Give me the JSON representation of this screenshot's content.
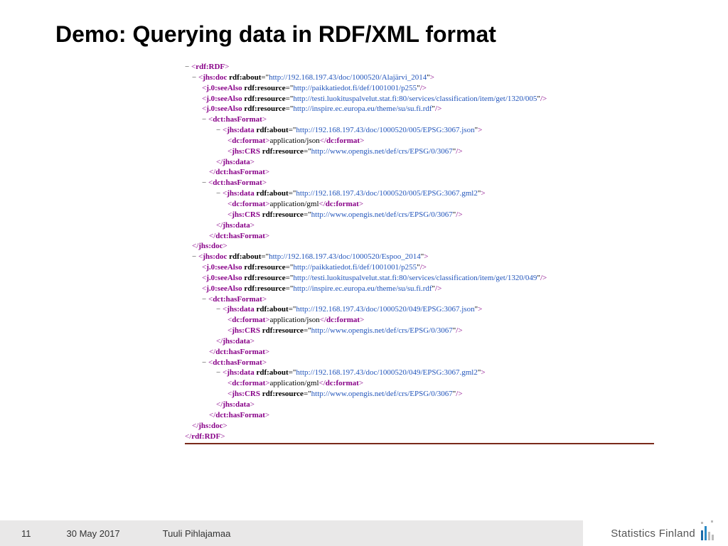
{
  "title": "Demo: Querying data in RDF/XML format",
  "footer": {
    "page": "11",
    "date": "30 May 2017",
    "author": "Tuuli Pihlajamaa"
  },
  "logo": "Statistics Finland",
  "xml": {
    "rdfOpen": "rdf:RDF",
    "rdfClose": "rdf:RDF",
    "docs": [
      {
        "about": "http://192.168.197.43/doc/1000520/Alajärvi_2014",
        "seeAlso": [
          "http://paikkatiedot.fi/def/1001001/p255",
          "http://testi.luokituspalvelut.stat.fi:80/services/classification/item/get/1320/005",
          "http://inspire.ec.europa.eu/theme/su/su.fi.rdf"
        ],
        "formats": [
          {
            "dataAbout": "http://192.168.197.43/doc/1000520/005/EPSG:3067.json",
            "format": "application/json",
            "crs": "http://www.opengis.net/def/crs/EPSG/0/3067"
          },
          {
            "dataAbout": "http://192.168.197.43/doc/1000520/005/EPSG:3067.gml2",
            "format": "application/gml",
            "crs": "http://www.opengis.net/def/crs/EPSG/0/3067"
          }
        ]
      },
      {
        "about": "http://192.168.197.43/doc/1000520/Espoo_2014",
        "seeAlso": [
          "http://paikkatiedot.fi/def/1001001/p255",
          "http://testi.luokituspalvelut.stat.fi:80/services/classification/item/get/1320/049",
          "http://inspire.ec.europa.eu/theme/su/su.fi.rdf"
        ],
        "formats": [
          {
            "dataAbout": "http://192.168.197.43/doc/1000520/049/EPSG:3067.json",
            "format": "application/json",
            "crs": "http://www.opengis.net/def/crs/EPSG/0/3067"
          },
          {
            "dataAbout": "http://192.168.197.43/doc/1000520/049/EPSG:3067.gml2",
            "format": "application/gml",
            "crs": "http://www.opengis.net/def/crs/EPSG/0/3067"
          }
        ]
      }
    ]
  }
}
